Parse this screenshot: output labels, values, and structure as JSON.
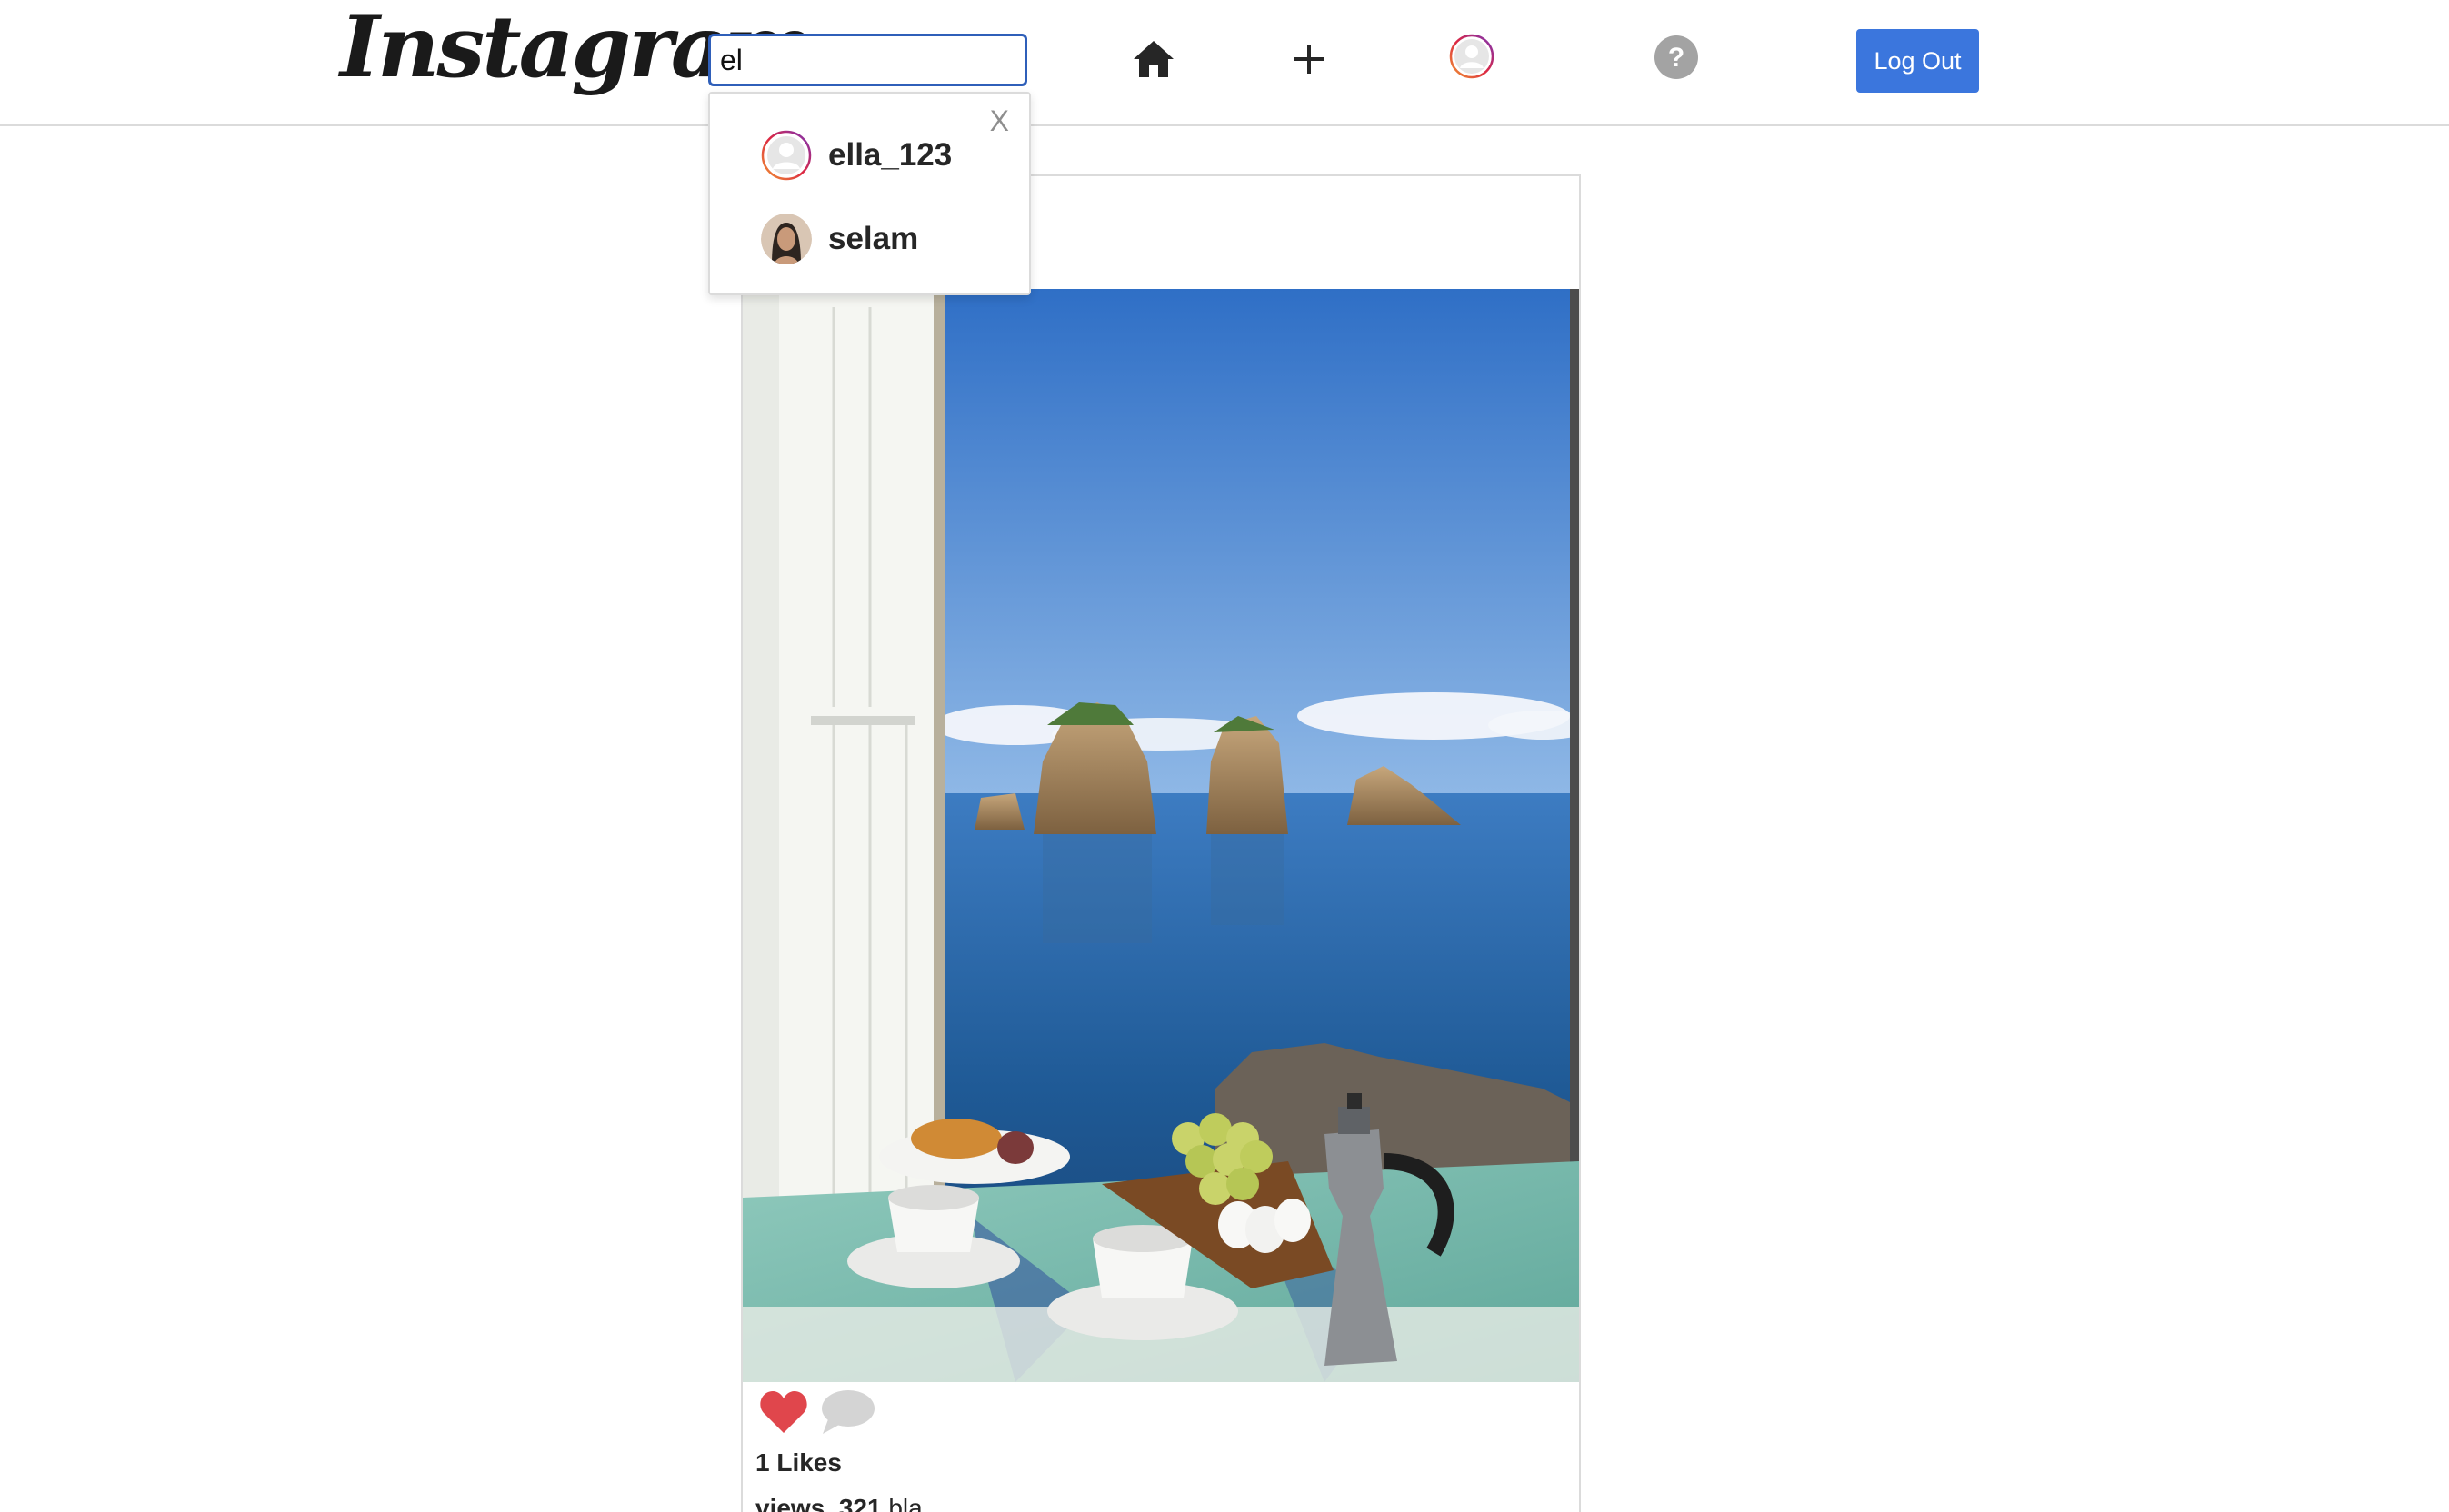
{
  "header": {
    "logo_text": "Instagram",
    "search": {
      "value": "el",
      "placeholder": ""
    },
    "logout_label": "Log Out",
    "icons": [
      "home-icon",
      "plus-icon",
      "avatar-icon",
      "help-icon"
    ],
    "accent_color": "#3b76dd"
  },
  "search_results": {
    "close_label": "X",
    "items": [
      {
        "username": "ella_123",
        "avatar": "default-avatar"
      },
      {
        "username": "selam",
        "avatar": "photo-avatar"
      }
    ]
  },
  "post": {
    "image_description_icon": "photo",
    "likes_label": "1 Likes",
    "caption_user": "views_321",
    "caption_text": "bla",
    "like_color": "#e0464c"
  }
}
